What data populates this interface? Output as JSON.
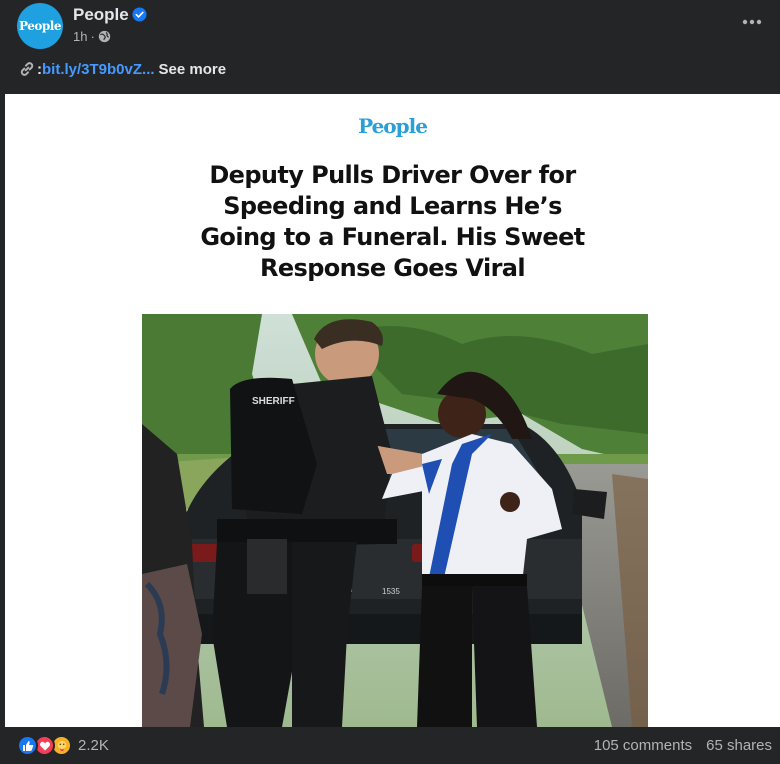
{
  "header": {
    "avatar_text": "People",
    "page_name": "People",
    "timestamp": "1h",
    "dot": "·",
    "verified_icon": "verified-badge-icon",
    "audience_icon": "globe-icon",
    "more_icon": "more-options-icon"
  },
  "caption": {
    "link_icon": "link-icon",
    "colon": ":",
    "link_text": "bit.ly/3T9b0vZ...",
    "see_more": "See more"
  },
  "article": {
    "brand": "People",
    "headline_lines": [
      "Deputy Pulls Driver Over for",
      "Speeding and Learns He’s",
      "Going to a Funeral. His Sweet",
      "Response Goes Viral"
    ],
    "photo_icon": "article-photo",
    "shirt_text": "SHERIFF",
    "plate_text": "1535"
  },
  "footer": {
    "reaction_icons": [
      "like-icon",
      "love-icon",
      "care-icon"
    ],
    "reaction_count": "2.2K",
    "comments": "105 comments",
    "shares": "65 shares"
  },
  "colors": {
    "background": "#242526",
    "text": "#e4e6eb",
    "secondary_text": "#b0b3b8",
    "link": "#4599ff",
    "brand_blue": "#2a9fd8",
    "like_blue": "#1877f2",
    "love_red": "#f33e58",
    "care_yellow": "#f7b125"
  }
}
